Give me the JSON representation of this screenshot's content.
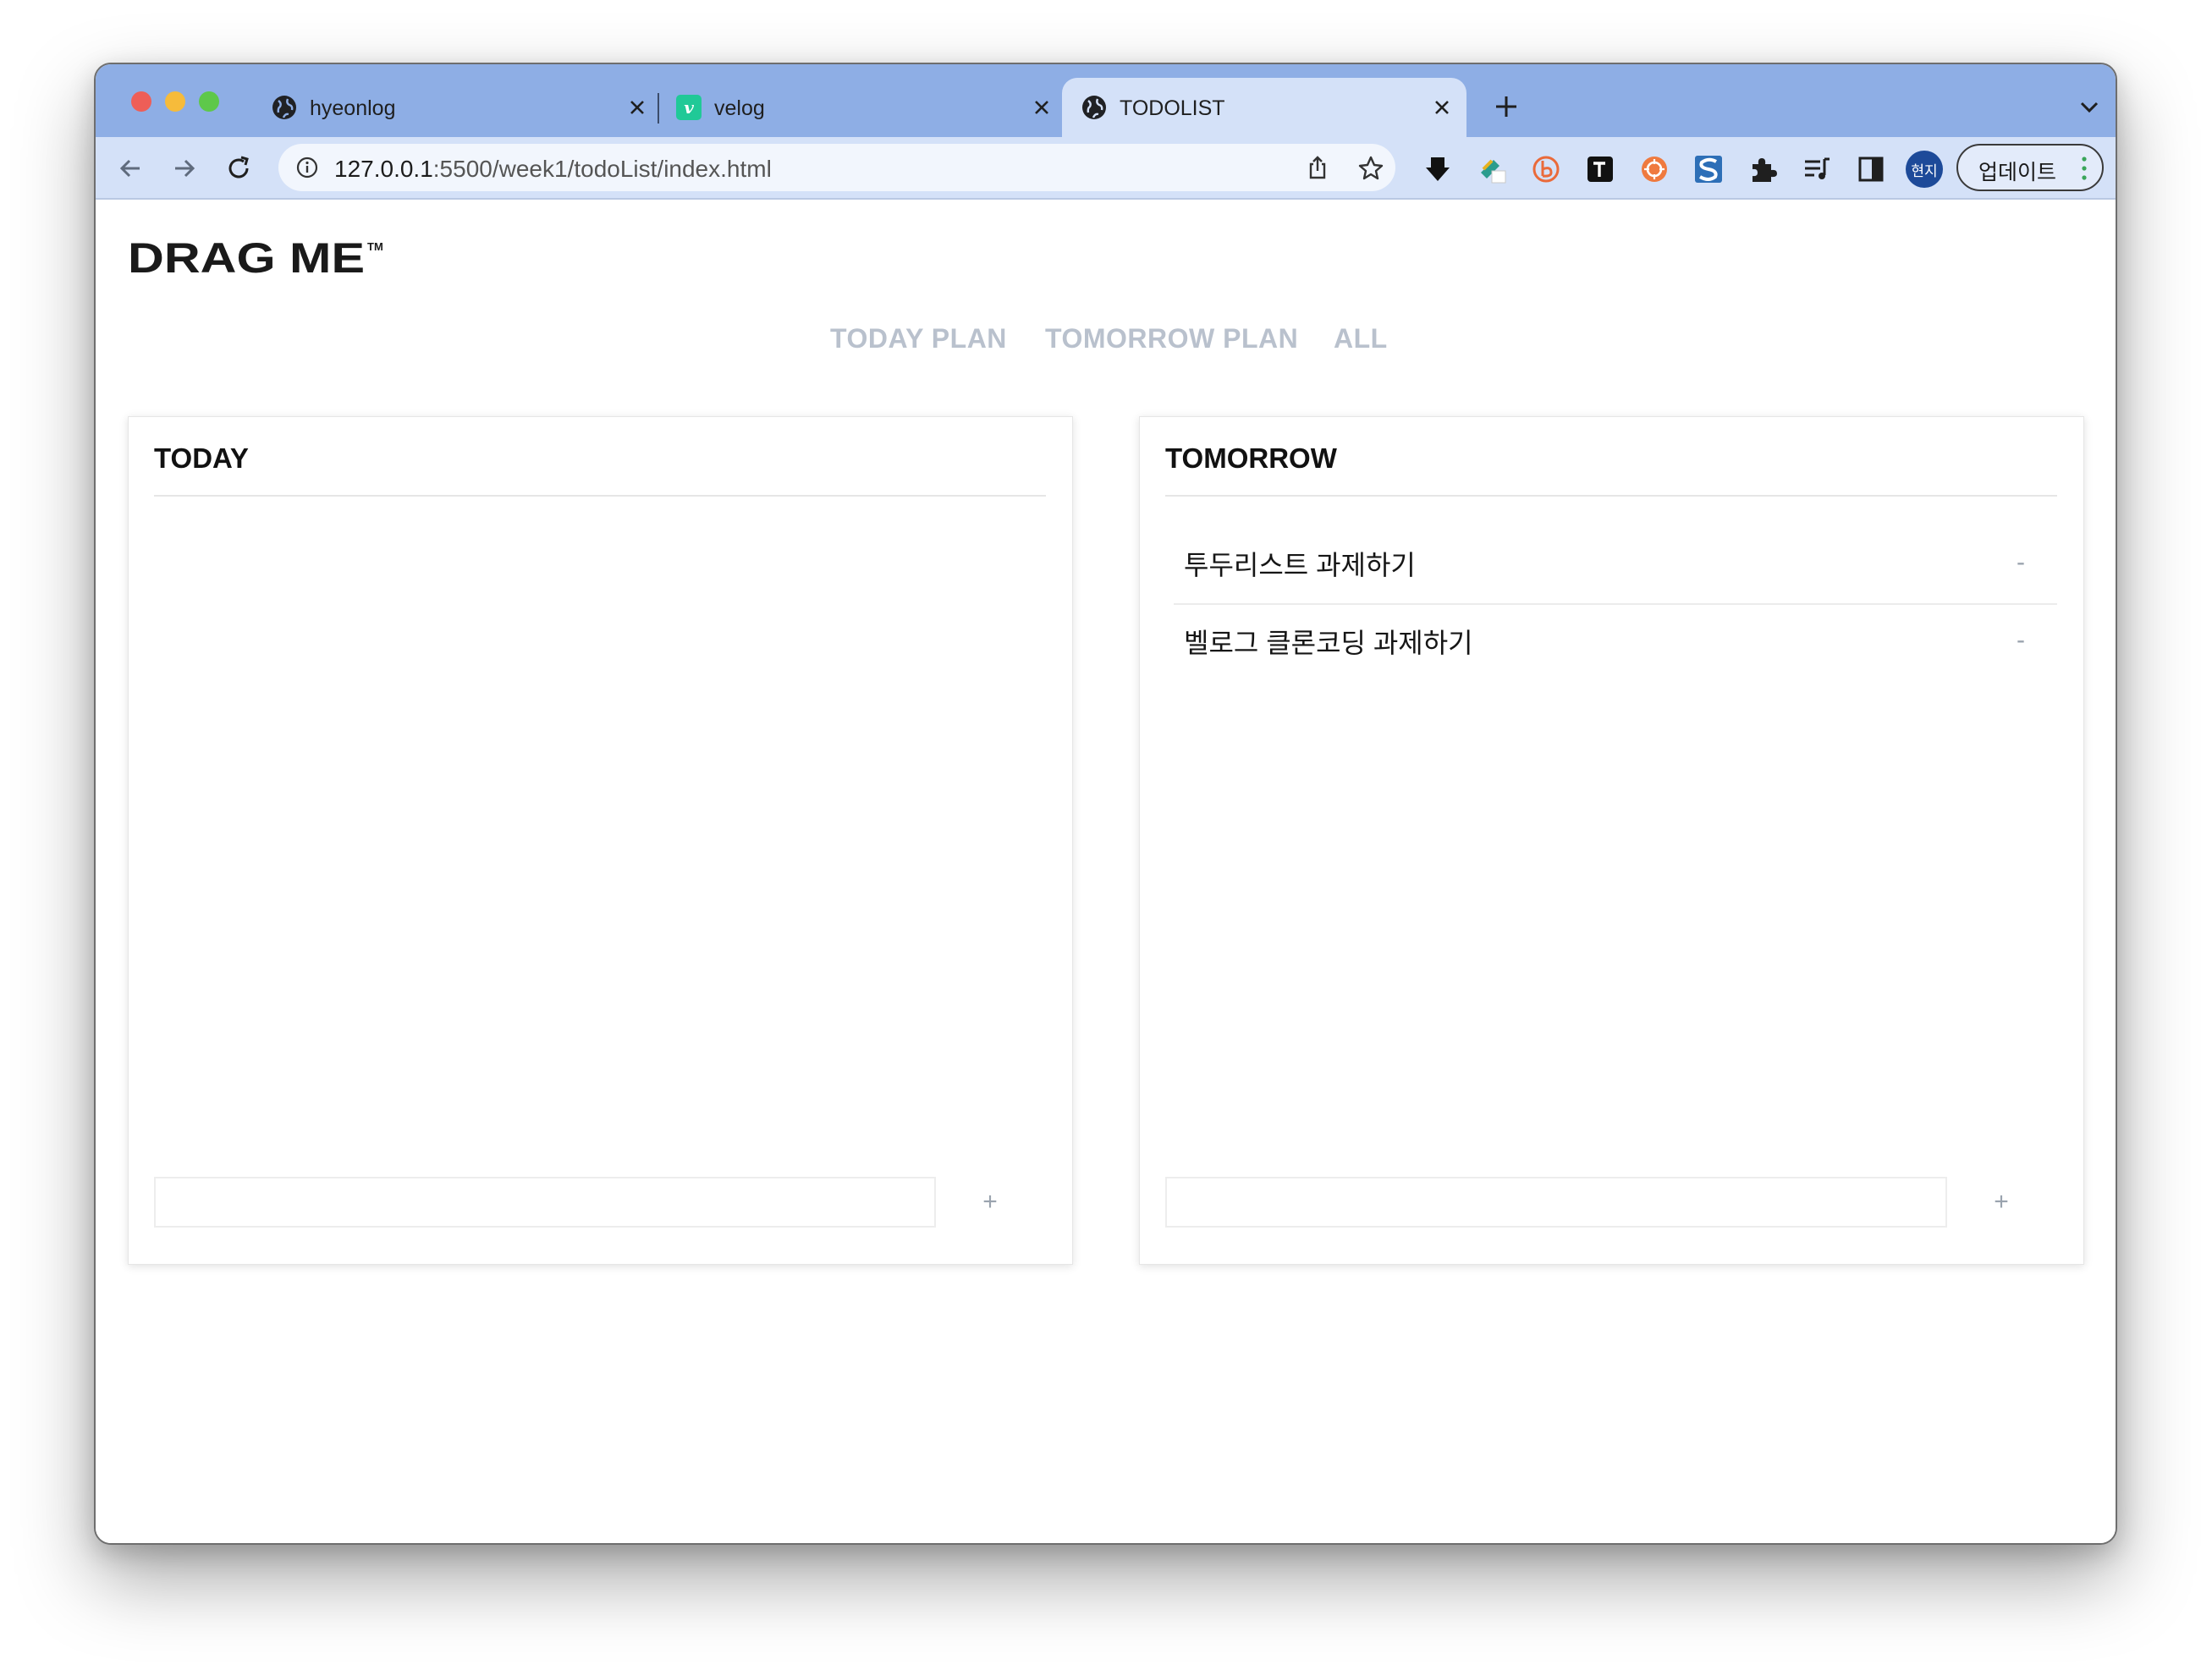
{
  "browser": {
    "tabs": [
      {
        "title": "hyeonlog",
        "icon": "globe-icon",
        "active": false
      },
      {
        "title": "velog",
        "icon": "velog-icon",
        "favicon_letter": "v",
        "active": false
      },
      {
        "title": "TODOLIST",
        "icon": "globe-icon",
        "active": true
      }
    ],
    "url_host": "127.0.0.1",
    "url_rest": ":5500/week1/todoList/index.html",
    "profile_initials": "현지",
    "update_label": "업데이트",
    "colors": {
      "tabstrip": "#8eaee5",
      "toolbar": "#d4e1f8",
      "profile": "#1d4a99"
    }
  },
  "page": {
    "logo_text": "DRAG ME",
    "logo_tm": "TM",
    "nav": [
      "TODAY PLAN",
      "TOMORROW PLAN",
      "ALL"
    ],
    "today": {
      "title": "TODAY",
      "items": [],
      "add_label": "+"
    },
    "tomorrow": {
      "title": "TOMORROW",
      "items": [
        {
          "text": "투두리스트 과제하기",
          "remove_label": "-"
        },
        {
          "text": "벨로그 클론코딩 과제하기",
          "remove_label": "-"
        }
      ],
      "add_label": "+"
    }
  }
}
